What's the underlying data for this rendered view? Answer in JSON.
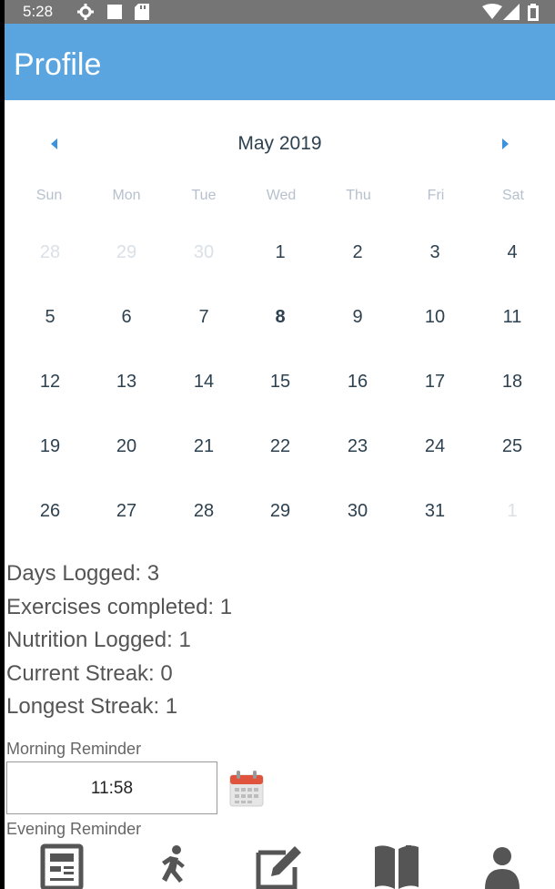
{
  "status_bar": {
    "time": "5:28"
  },
  "app_bar": {
    "title": "Profile"
  },
  "calendar": {
    "month_label": "May 2019",
    "weekdays": [
      "Sun",
      "Mon",
      "Tue",
      "Wed",
      "Thu",
      "Fri",
      "Sat"
    ],
    "weeks": [
      [
        {
          "d": "28",
          "muted": true
        },
        {
          "d": "29",
          "muted": true
        },
        {
          "d": "30",
          "muted": true
        },
        {
          "d": "1"
        },
        {
          "d": "2"
        },
        {
          "d": "3"
        },
        {
          "d": "4"
        }
      ],
      [
        {
          "d": "5"
        },
        {
          "d": "6"
        },
        {
          "d": "7"
        },
        {
          "d": "8",
          "today": true
        },
        {
          "d": "9"
        },
        {
          "d": "10"
        },
        {
          "d": "11"
        }
      ],
      [
        {
          "d": "12"
        },
        {
          "d": "13"
        },
        {
          "d": "14"
        },
        {
          "d": "15"
        },
        {
          "d": "16"
        },
        {
          "d": "17"
        },
        {
          "d": "18"
        }
      ],
      [
        {
          "d": "19"
        },
        {
          "d": "20"
        },
        {
          "d": "21"
        },
        {
          "d": "22"
        },
        {
          "d": "23"
        },
        {
          "d": "24"
        },
        {
          "d": "25"
        }
      ],
      [
        {
          "d": "26"
        },
        {
          "d": "27"
        },
        {
          "d": "28"
        },
        {
          "d": "29"
        },
        {
          "d": "30"
        },
        {
          "d": "31"
        },
        {
          "d": "1",
          "muted": true
        }
      ]
    ]
  },
  "stats": {
    "days_logged": "Days Logged: 3",
    "exercises_completed": "Exercises completed: 1",
    "nutrition_logged": "Nutrition Logged: 1",
    "current_streak": "Current Streak: 0",
    "longest_streak": "Longest Streak: 1"
  },
  "reminders": {
    "morning_label": "Morning Reminder",
    "morning_time": "11:58",
    "evening_label": "Evening Reminder",
    "evening_time": ""
  },
  "bottom_nav": [
    {
      "icon": "newspaper-icon"
    },
    {
      "icon": "running-icon"
    },
    {
      "icon": "edit-icon"
    },
    {
      "icon": "book-icon"
    },
    {
      "icon": "user-icon"
    }
  ],
  "colors": {
    "app_bar": "#5aa5e0",
    "status_bar": "#757575",
    "arrow": "#3b93e0",
    "calendar_icon_red": "#e0533d"
  }
}
